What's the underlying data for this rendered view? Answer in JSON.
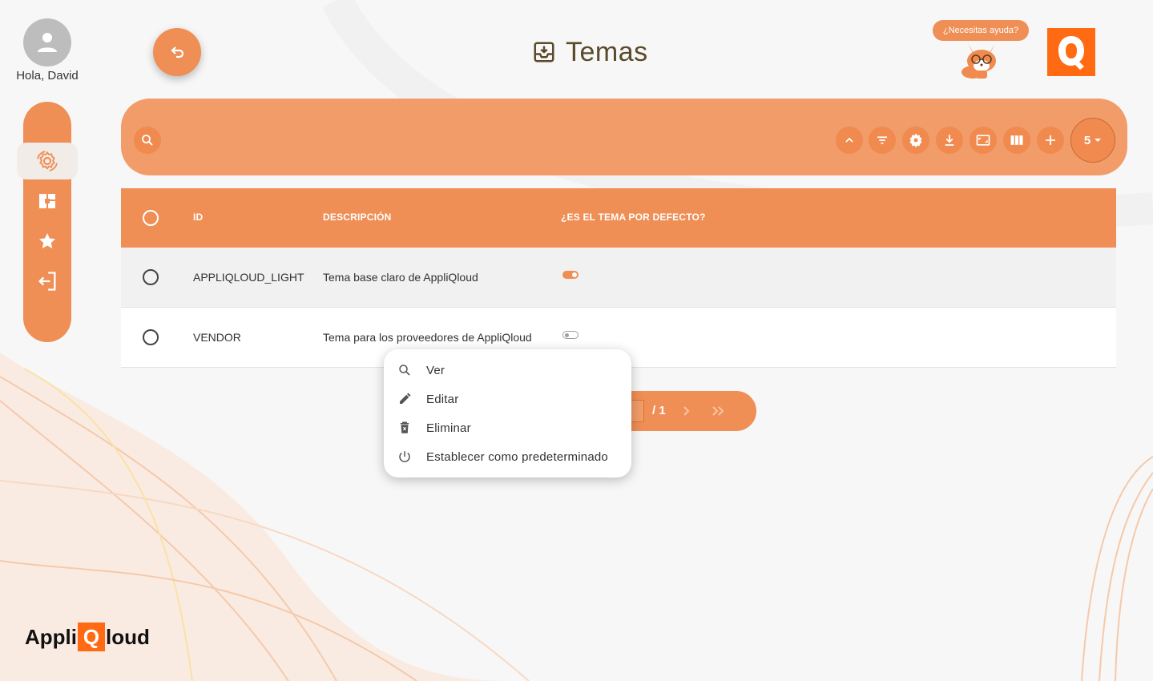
{
  "user": {
    "greeting": "Hola, David"
  },
  "sidebar": {
    "items": [
      {
        "name": "settings-gear-icon",
        "active": true
      },
      {
        "name": "dashboard-icon",
        "active": false
      },
      {
        "name": "star-icon",
        "active": false
      },
      {
        "name": "logout-icon",
        "active": false
      }
    ]
  },
  "header": {
    "title": "Temas",
    "help_text": "¿Necesitas ayuda?"
  },
  "toolbar": {
    "buttons": [
      "chevron-up-icon",
      "filter-icon",
      "gear-icon",
      "download-icon",
      "fullscreen-icon",
      "columns-icon",
      "plus-icon"
    ],
    "rows_per_page": "5"
  },
  "table": {
    "columns": [
      "ID",
      "DESCRIPCIÓN",
      "¿ES EL TEMA POR DEFECTO?"
    ],
    "rows": [
      {
        "id": "APPLIQLOUD_LIGHT",
        "description": "Tema base claro de AppliQloud",
        "is_default": true
      },
      {
        "id": "VENDOR",
        "description": "Tema para los proveedores de AppliQloud",
        "is_default": false
      }
    ]
  },
  "pagination": {
    "total": "/ 1"
  },
  "context_menu": {
    "items": [
      {
        "label": "Ver",
        "icon": "search-icon"
      },
      {
        "label": "Editar",
        "icon": "pencil-icon"
      },
      {
        "label": "Eliminar",
        "icon": "trash-icon"
      },
      {
        "label": "Establecer como predeterminado",
        "icon": "power-icon"
      }
    ]
  },
  "brand": {
    "prefix": "Appli",
    "q": "Q",
    "suffix": "loud"
  },
  "colors": {
    "accent": "#ef8e55",
    "toolbar": "#f19c69",
    "logo": "#ff6a13"
  }
}
